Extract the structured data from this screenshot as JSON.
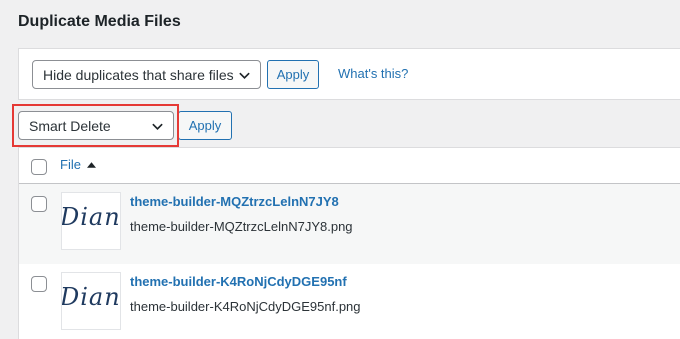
{
  "page": {
    "title": "Duplicate Media Files"
  },
  "filter": {
    "select_value": "Hide duplicates that share files",
    "apply_label": "Apply",
    "help_link": "What's this?"
  },
  "bulk": {
    "select_value": "Smart Delete",
    "apply_label": "Apply"
  },
  "table": {
    "column_file": "File",
    "rows": [
      {
        "title": "theme-builder-MQZtrzcLelnN7JY8",
        "filename": "theme-builder-MQZtrzcLelnN7JY8.png",
        "thumb_text": "Dian"
      },
      {
        "title": "theme-builder-K4RoNjCdyDGE95nf",
        "filename": "theme-builder-K4RoNjCdyDGE95nf.png",
        "thumb_text": "Dian"
      }
    ]
  },
  "colors": {
    "accent": "#2271b1",
    "highlight": "#e53935",
    "background": "#f0f0f1"
  }
}
